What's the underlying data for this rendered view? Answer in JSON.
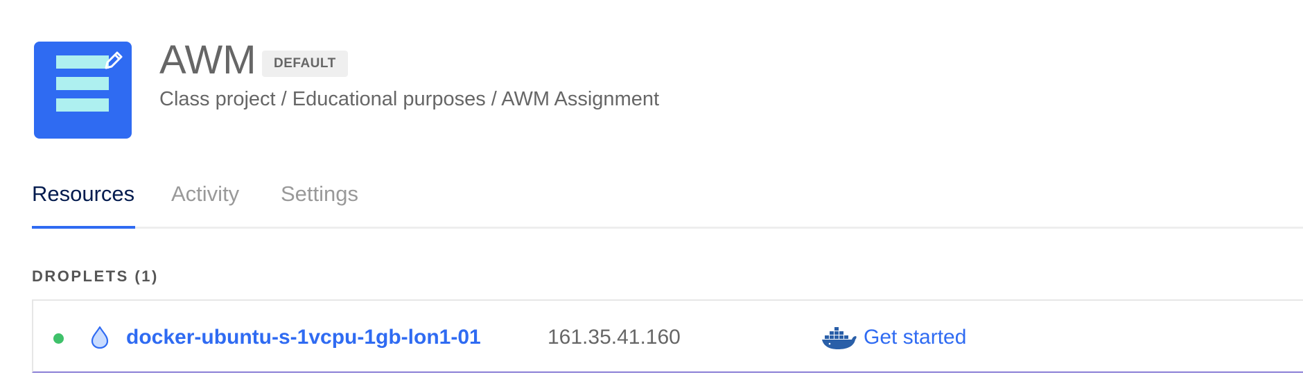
{
  "project": {
    "name": "AWM",
    "badge": "DEFAULT",
    "description": "Class project / Educational purposes / AWM Assignment",
    "icon_name": "project-list-icon",
    "icon_color": "#2f6bf2"
  },
  "tabs": [
    {
      "label": "Resources",
      "active": true
    },
    {
      "label": "Activity",
      "active": false
    },
    {
      "label": "Settings",
      "active": false
    }
  ],
  "droplets_section": {
    "title": "DROPLETS (1)",
    "rows": [
      {
        "status": "active",
        "status_color": "#3fc16a",
        "name": "docker-ubuntu-s-1vcpu-1gb-lon1-01",
        "ip": "161.35.41.160",
        "action_icon": "docker-icon",
        "action_label": "Get started"
      }
    ]
  },
  "colors": {
    "accent": "#2f6bf2",
    "tab_active": "#031b4e",
    "tab_inactive": "#999999"
  }
}
